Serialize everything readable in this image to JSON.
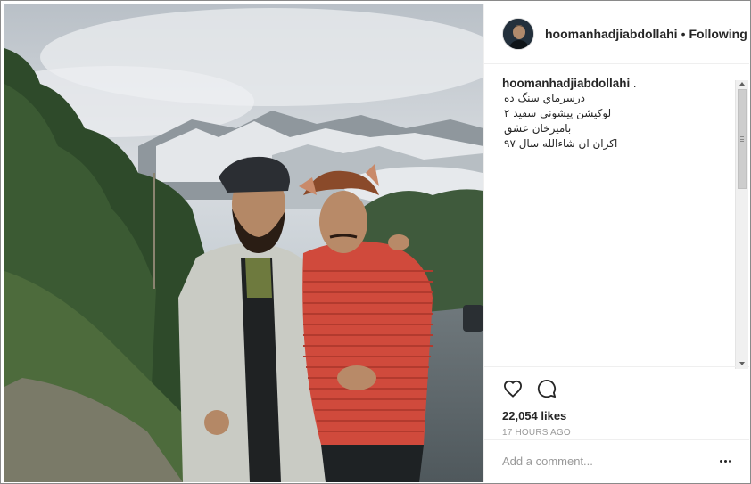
{
  "post": {
    "username": "hoomanhadjiabdollahi",
    "separator": "•",
    "follow_status": "Following",
    "caption": {
      "username": "hoomanhadjiabdollahi",
      "punctuation": ".",
      "lines": [
        "درسرماي سنگ ده",
        "لوكيشن پيشوني سفيد ٢",
        "باميرخان عشق",
        "اكران ان شاءالله سال ٩٧"
      ]
    },
    "likes": "22,054 likes",
    "timestamp": "17 HOURS AGO",
    "comment_placeholder": "Add a comment..."
  },
  "icons": {
    "like": "heart-icon",
    "comment": "speech-bubble-icon",
    "more": "more-options-icon"
  },
  "colors": {
    "text": "#262626",
    "muted": "#999999",
    "border": "#efefef"
  }
}
